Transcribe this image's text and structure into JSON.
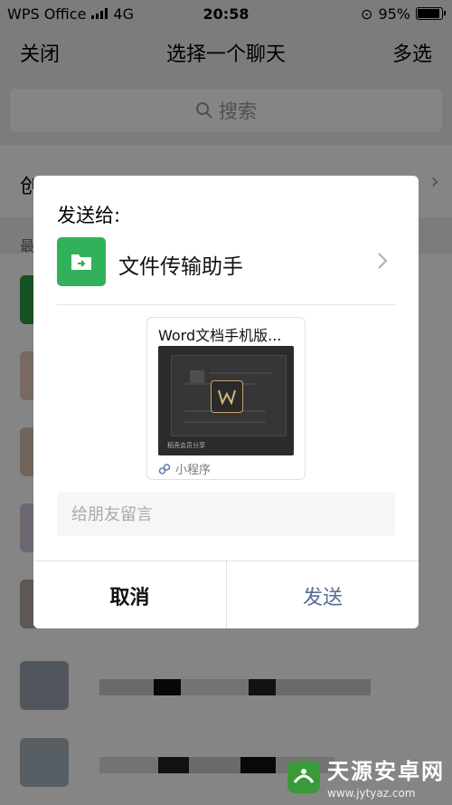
{
  "status_bar": {
    "carrier": "WPS Office",
    "network": "4G",
    "time": "20:58",
    "battery": "95%"
  },
  "nav": {
    "close_label": "关闭",
    "title": "选择一个聊天",
    "multi_select_label": "多选"
  },
  "search": {
    "placeholder": "搜索"
  },
  "background_list": {
    "new_chat_label": "创建新的聊天",
    "recent_label": "最"
  },
  "dialog": {
    "title": "发送给:",
    "recipient_name": "文件传输助手",
    "card": {
      "title": "Word文档手机版...",
      "thumb_caption": "稻壳会员分享",
      "footer_label": "小程序"
    },
    "message_placeholder": "给朋友留言",
    "cancel_label": "取消",
    "send_label": "发送"
  },
  "watermark": {
    "text": "天源安卓网",
    "url": "www.jytyaz.com"
  },
  "colors": {
    "accent_green": "#30b15a",
    "send_blue": "#576b95",
    "dim_overlay": "rgba(0,0,0,0.48)"
  }
}
